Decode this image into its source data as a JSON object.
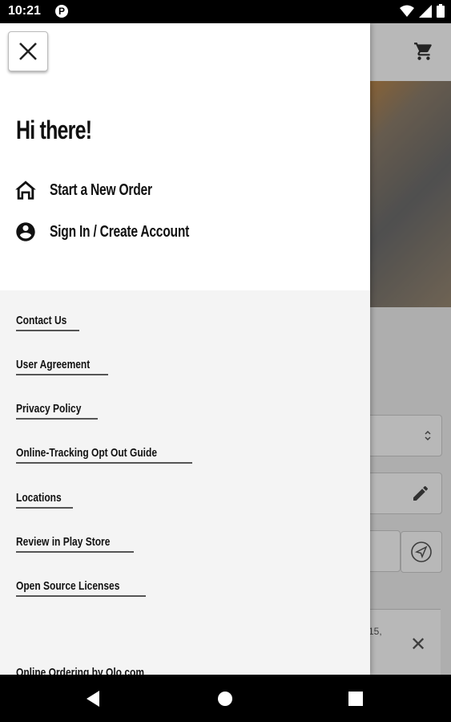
{
  "status_bar": {
    "time": "10:21",
    "app_icon_glyph": "P"
  },
  "drawer": {
    "greeting": "Hi there!",
    "primary_items": [
      {
        "label": "Start a New Order",
        "icon": "home-icon"
      },
      {
        "label": "Sign In / Create Account",
        "icon": "account-circle-icon"
      }
    ],
    "links": [
      "Contact Us",
      "User Agreement",
      "Privacy Policy",
      "Online-Tracking Opt Out Guide",
      "Locations",
      "Review in Play Store",
      "Open Source Licenses"
    ],
    "footer": "Online Ordering by Olo.com"
  },
  "background": {
    "note_fragment": "15,"
  },
  "colors": {
    "drawer_bg": "#f4f4f4",
    "header_bg": "#ffffff",
    "text": "#111111"
  }
}
